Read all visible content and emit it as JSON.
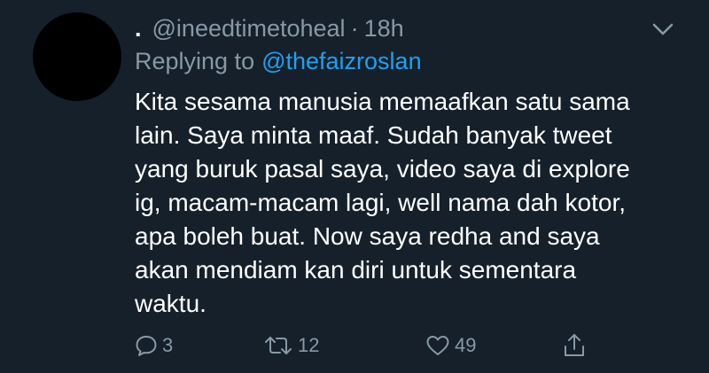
{
  "tweet": {
    "display_name": ".",
    "handle": "@ineedtimetoheal",
    "separator": "·",
    "time": "18h",
    "replying_prefix": "Replying to",
    "replying_handle": "@thefaizroslan",
    "body_lines": [
      "Kita sesama manusia memaafkan satu sama",
      "lain. Saya minta maaf. Sudah banyak tweet",
      "yang buruk pasal saya, video saya di explore",
      "ig, macam-macam lagi, well nama dah kotor,",
      "apa boleh buat. Now saya redha and saya",
      "akan mendiam kan diri untuk sementara",
      "waktu."
    ]
  },
  "actions": {
    "reply_count": "3",
    "retweet_count": "12",
    "like_count": "49"
  },
  "icons": {
    "caret": "chevron-down-icon",
    "reply": "comment-icon",
    "retweet": "retweet-icon",
    "like": "heart-icon",
    "share": "share-icon"
  },
  "colors": {
    "background": "#15202b",
    "secondary_text": "#8899a6",
    "link": "#1da1f2",
    "avatar": "#000000"
  }
}
